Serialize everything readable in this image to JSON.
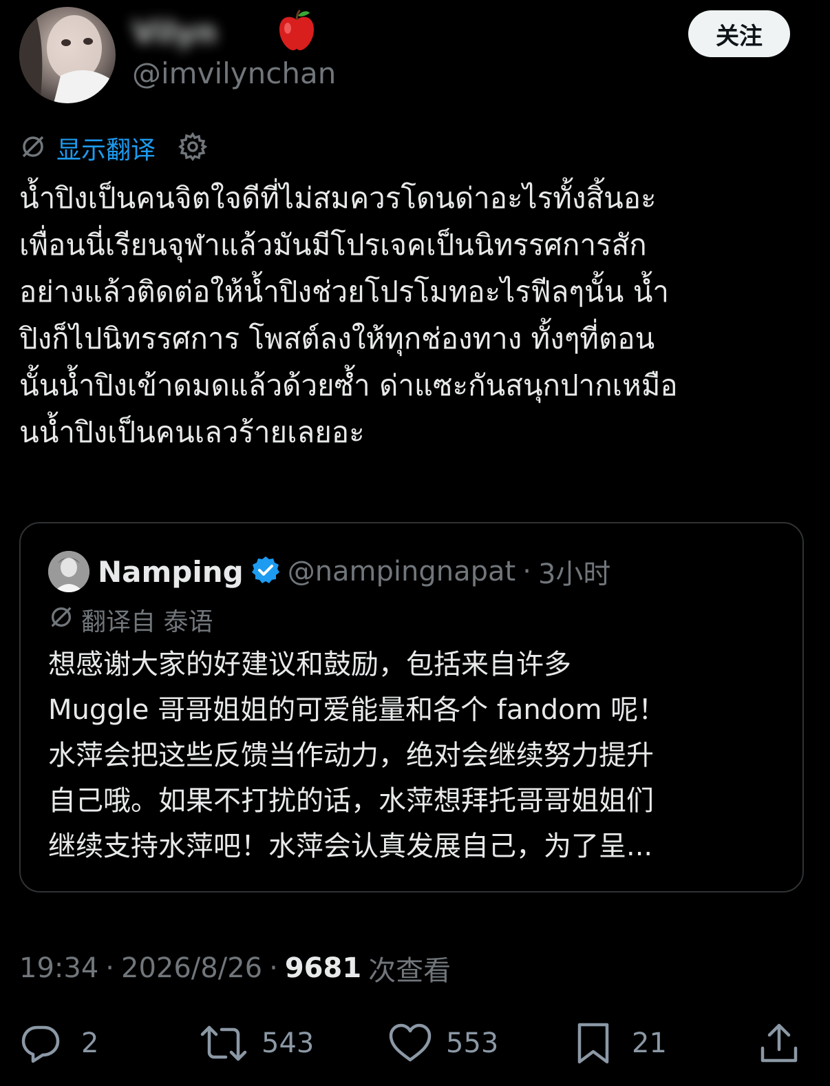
{
  "author": {
    "display_name": "Vilyn",
    "emoji": "🍎",
    "handle": "@imvilynchan"
  },
  "follow_label": "关注",
  "translation": {
    "show_label": "显示翻译"
  },
  "tweet": {
    "text": "น้ำปิงเป็นคนจิตใจดีที่ไม่สมควรโดนด่าอะไรทั้งสิ้นอะ\nเพื่อนนี่เรียนจุฬาแล้วมันมีโปรเจคเป็นนิทรรศการสัก\nอย่างแล้วติดต่อให้น้ำปิงช่วยโปรโมทอะไรฟีลๆนั้น น้ำ\nปิงก็ไปนิทรรศการ โพสต์ลงให้ทุกช่องทาง ทั้งๆที่ตอน\nนั้นน้ำปิงเข้าดมดแล้วด้วยซ้ำ ด่าแซะกันสนุกปากเหมือ\nนน้ำปิงเป็นคนเลวร้ายเลยอะ"
  },
  "quote": {
    "name": "Namping",
    "handle": "@nampingnapat",
    "separator": "·",
    "time": "3小时",
    "translated_from": "翻译自 泰语",
    "text": "想感谢大家的好建议和鼓励，包括来自许多\nMuggle 哥哥姐姐的可爱能量和各个 fandom 呢！\n水萍会把这些反馈当作动力，绝对会继续努力提升\n自己哦。如果不打扰的话，水萍想拜托哥哥姐姐们\n继续支持水萍吧！水萍会认真发展自己，为了呈..."
  },
  "meta": {
    "time": "19:34",
    "sep1": "·",
    "date": "2026/8/26",
    "sep2": "·",
    "views": "9681",
    "views_label": "次查看"
  },
  "actions": {
    "replies": "2",
    "retweets": "543",
    "likes": "553",
    "bookmarks": "21"
  },
  "colors": {
    "background": "#000000",
    "text": "#e7e9ea",
    "muted": "#71767b",
    "link": "#1d9bf0",
    "verified": "#1d9bf0"
  },
  "icons": [
    "translate-icon",
    "gear-icon",
    "verified-badge-icon",
    "reply-icon",
    "retweet-icon",
    "like-icon",
    "bookmark-icon",
    "share-icon"
  ]
}
